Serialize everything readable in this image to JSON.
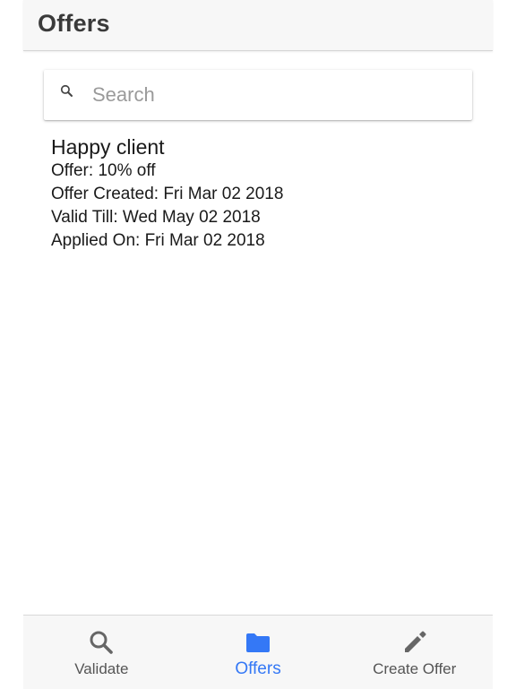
{
  "header": {
    "title": "Offers"
  },
  "search": {
    "placeholder": "Search",
    "value": ""
  },
  "offers": [
    {
      "name": "Happy client",
      "offer": "Offer: 10% off",
      "created": "Offer Created: Fri Mar 02 2018",
      "valid_till": "Valid Till: Wed May 02 2018",
      "applied_on": "Applied On: Fri Mar 02 2018"
    }
  ],
  "tabs": [
    {
      "label": "Validate",
      "icon": "search-icon",
      "active": false
    },
    {
      "label": "Offers",
      "icon": "folder-icon",
      "active": true
    },
    {
      "label": "Create Offer",
      "icon": "pencil-icon",
      "active": false
    }
  ],
  "colors": {
    "accent": "#3478f6",
    "inactive_icon": "#666666",
    "header_bg": "#f7f7f7"
  }
}
